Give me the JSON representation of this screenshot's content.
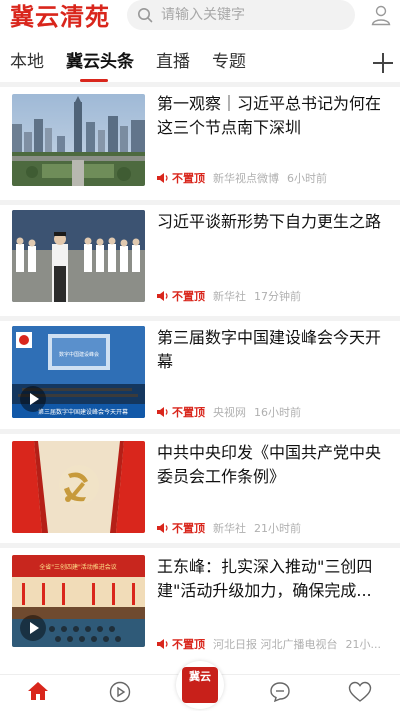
{
  "header": {
    "logo": "冀云清苑",
    "search_placeholder": "请输入关键字"
  },
  "tabs": [
    {
      "label": "本地"
    },
    {
      "label": "冀云头条"
    },
    {
      "label": "直播"
    },
    {
      "label": "专题"
    }
  ],
  "news": [
    {
      "title": "第一观察｜习近平总书记为何在这三个节点南下深圳",
      "pin": "不置顶",
      "source": "新华视点微博",
      "time": "6小时前"
    },
    {
      "title": "习近平谈新形势下自力更生之路",
      "pin": "不置顶",
      "source": "新华社",
      "time": "17分钟前"
    },
    {
      "title": "第三届数字中国建设峰会今天开幕",
      "pin": "不置顶",
      "source": "央视网",
      "time": "16小时前"
    },
    {
      "title": "中共中央印发《中国共产党中央委员会工作条例》",
      "pin": "不置顶",
      "source": "新华社",
      "time": "21小时前"
    },
    {
      "title": "王东峰：扎实深入推动\"三创四建\"活动升级加力，确保完成...",
      "pin": "不置顶",
      "source": "河北日报 河北广播电视台",
      "time": "21小..."
    }
  ],
  "thumb_texts": {
    "conference_banner": "数字中国建设峰会",
    "news_caption": "第三届数字中国建设峰会今天开幕",
    "meeting_banner": "全省\"三创四建\"活动推进会议"
  },
  "bottom_nav": {
    "home": "首页",
    "video": "视听",
    "center": "冀云",
    "ask": "问政",
    "service": "服务"
  },
  "colors": {
    "accent": "#d9261c",
    "meta_text": "#b0b0b0",
    "separator": "#f2f2f2"
  }
}
